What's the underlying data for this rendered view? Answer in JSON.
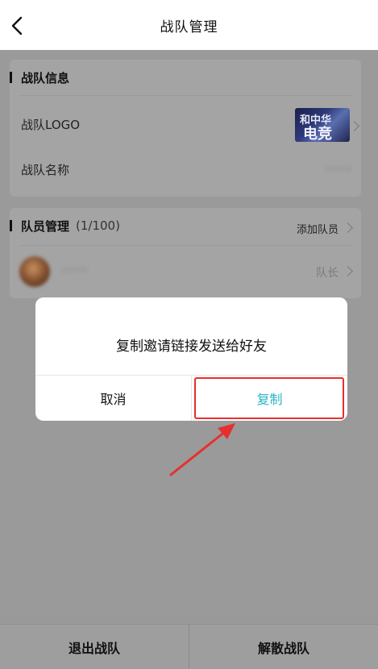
{
  "header": {
    "title": "战队管理",
    "back_icon": "chevron-left-icon"
  },
  "team_info": {
    "section_title": "战队信息",
    "logo_label": "战队LOGO",
    "logo_text_top": "和中华",
    "logo_text_main": "电竞",
    "name_label": "战队名称",
    "name_value": "••••"
  },
  "members": {
    "section_title": "队员管理",
    "count": "(1/100)",
    "add_label": "添加队员",
    "list": [
      {
        "name": "••••",
        "role": "队长"
      }
    ]
  },
  "dialog": {
    "message": "复制邀请链接发送给好友",
    "cancel_label": "取消",
    "confirm_label": "复制",
    "accent_color": "#2bb3c8"
  },
  "annotation": {
    "highlight_color": "#e53030"
  },
  "bottom_bar": {
    "leave_label": "退出战队",
    "disband_label": "解散战队"
  }
}
